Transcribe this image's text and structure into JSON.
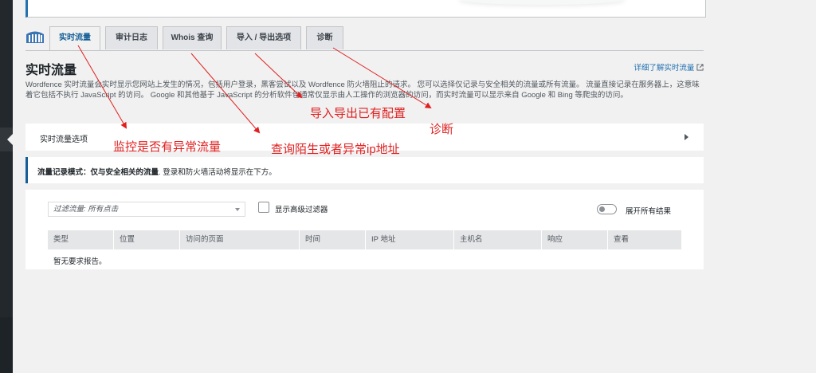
{
  "tabs": [
    {
      "label": "实时流量",
      "active": true
    },
    {
      "label": "审计日志",
      "active": false
    },
    {
      "label": "Whois 查询",
      "active": false
    },
    {
      "label": "导入 / 导出选项",
      "active": false
    },
    {
      "label": "诊断",
      "active": false
    }
  ],
  "page": {
    "title": "实时流量",
    "learn_more": "详细了解实时流量",
    "description": "Wordfence 实时流量会实时显示您网站上发生的情况，包括用户登录，黑客尝试以及 Wordfence 防火墙阻止的请求。 您可以选择仅记录与安全相关的流量或所有流量。 流量直接记录在服务器上，这意味着它包括不执行 JavaScript 的访问。 Google 和其他基于 JavaScript 的分析软件包通常仅显示由人工操作的浏览器的访问，而实时流量可以显示来自 Google 和 Bing 等爬虫的访问。"
  },
  "options_bar": {
    "label": "实时流量选项"
  },
  "mode_notice": {
    "label": "流量记录模式：仅与安全相关的流量",
    "text": ". 登录和防火墙活动将显示在下方。"
  },
  "filter": {
    "select_value": "过滤流量: 所有点击",
    "advanced_label": "显示高级过滤器",
    "expand_label": "展开所有结果"
  },
  "table": {
    "columns": [
      "类型",
      "位置",
      "访问的页面",
      "时间",
      "IP 地址",
      "主机名",
      "响应",
      "查看"
    ],
    "empty_text": "暂无要求报告。"
  },
  "annotations": {
    "import_export": "导入导出已有配置",
    "diagnostics": "诊断",
    "monitor": "监控是否有异常流量",
    "whois": "查询陌生或者异常ip地址"
  },
  "colors": {
    "accent": "#2271b1",
    "annotation": "#e02020"
  }
}
